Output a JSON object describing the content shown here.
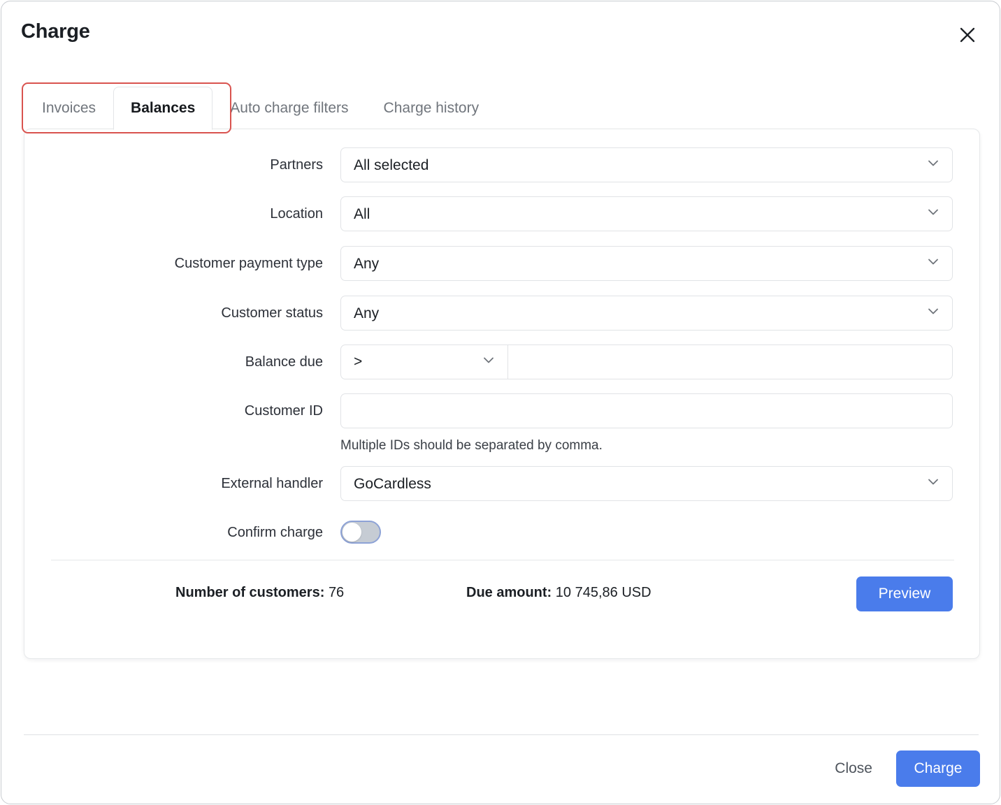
{
  "header": {
    "title": "Charge",
    "close_icon": "close-icon"
  },
  "tabs": [
    {
      "label": "Invoices",
      "active": false
    },
    {
      "label": "Balances",
      "active": true
    },
    {
      "label": "Auto charge filters",
      "active": false
    },
    {
      "label": "Charge history",
      "active": false
    }
  ],
  "annotation": {
    "color": "#d9534f"
  },
  "form": {
    "partners": {
      "label": "Partners",
      "value": "All selected",
      "icon": "chevron-down-icon"
    },
    "location": {
      "label": "Location",
      "value": "All",
      "icon": "chevron-down-icon"
    },
    "customer_payment_type": {
      "label": "Customer payment type",
      "value": "Any",
      "icon": "chevron-down-icon"
    },
    "customer_status": {
      "label": "Customer status",
      "value": "Any",
      "icon": "chevron-down-icon"
    },
    "balance_due": {
      "label": "Balance due",
      "operator": ">",
      "amount": "",
      "amount_placeholder": "",
      "icon": "chevron-down-icon"
    },
    "customer_id": {
      "label": "Customer ID",
      "value": "",
      "placeholder": "",
      "help": "Multiple IDs should be separated by comma."
    },
    "external_handler": {
      "label": "External handler",
      "value": "GoCardless",
      "icon": "chevron-down-icon"
    },
    "confirm_charge": {
      "label": "Confirm charge",
      "state": "off"
    }
  },
  "summary": {
    "customers_label": "Number of customers:",
    "customers_value": "76",
    "due_label": "Due amount:",
    "due_value": "10 745,86 USD",
    "preview_label": "Preview"
  },
  "footer": {
    "close_label": "Close",
    "charge_label": "Charge"
  },
  "colors": {
    "primary": "#4a7ceb",
    "annotation": "#d9534f",
    "border": "#e1e3e6"
  }
}
